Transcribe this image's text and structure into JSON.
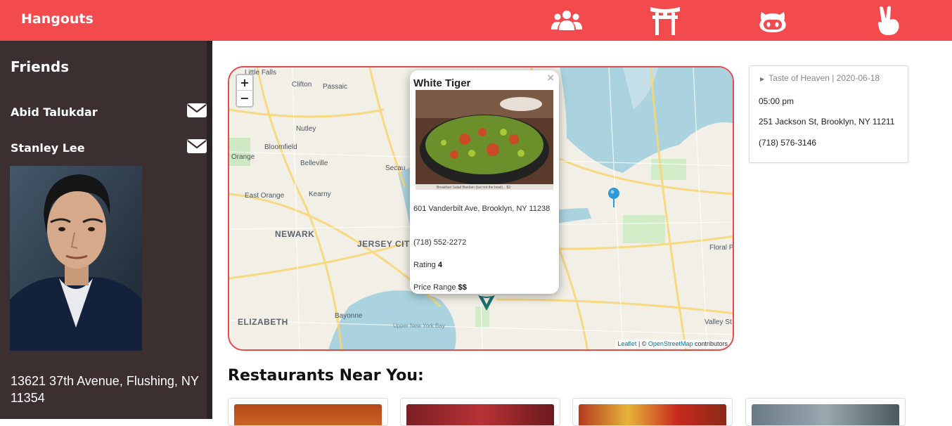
{
  "header": {
    "brand": "Hangouts",
    "nav_icons": [
      "users-icon",
      "torii-gate-icon",
      "github-icon",
      "peace-hand-icon"
    ],
    "background_color": "#f24a4d"
  },
  "sidebar": {
    "title": "Friends",
    "friends": [
      {
        "name": "Abid Talukdar",
        "icon": "envelope-icon"
      },
      {
        "name": "Stanley Lee",
        "icon": "envelope-icon"
      }
    ],
    "address": "13621 37th Avenue, Flushing, NY 11354",
    "background_color": "#3b2f30"
  },
  "map": {
    "zoom_in": "+",
    "zoom_out": "−",
    "labels": {
      "little_falls": "Little Falls",
      "clifton": "Clifton",
      "passaic": "Passaic",
      "nutley": "Nutley",
      "bloomfield": "Bloomfield",
      "belleville": "Belleville",
      "orange": "Orange",
      "east_orange": "East Orange",
      "kearny": "Kearny",
      "secaucus": "Secau",
      "newark": "NEWARK",
      "jersey_city": "JERSEY CITY",
      "elizabeth": "ELIZABETH",
      "bayonne": "Bayonne",
      "upper_bay": "Upper New York Bay",
      "floral_park": "Floral P",
      "valley_stream": "Valley St"
    },
    "attribution": {
      "leaflet": "Leaflet",
      "separator": " | © ",
      "osm": "OpenStreetMap",
      "suffix": " contributors"
    },
    "popup": {
      "close": "×",
      "title": "White Tiger",
      "address": "601 Vanderbilt Ave, Brooklyn, NY 11238",
      "phone": "(718) 552-2272",
      "rating_label": "Rating ",
      "rating_value": "4",
      "price_label": "Price Range ",
      "price_value": "$$",
      "image_caption": "Breakfast Salad Banban (but not the bowl)... $3"
    }
  },
  "event": {
    "header": "Taste of Heaven | 2020-06-18",
    "time": "05:00 pm",
    "address": "251 Jackson St, Brooklyn, NY 11211",
    "phone": "(718) 576-3146"
  },
  "restaurants": {
    "title": "Restaurants Near You:",
    "card_count": 4
  }
}
